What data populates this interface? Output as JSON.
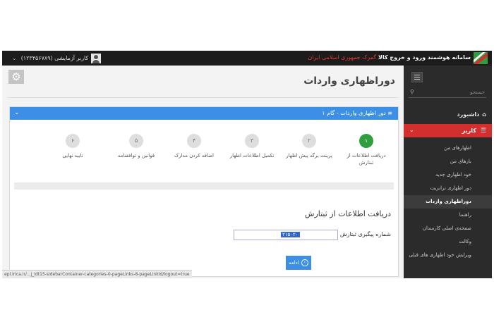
{
  "header": {
    "title_bold": "سامانه هوشمند ورود و خروج کالا",
    "title_org": "گمرک جمهوری اسلامی ایران",
    "user_label": "کاربر آزمایشی (۱۲۳۴۵۶۷۸۹)"
  },
  "sidebar": {
    "search_placeholder": "جستجو",
    "dashboard": "داشبورد",
    "active_section": "کاربر",
    "items": [
      {
        "label": "اظهارهای من"
      },
      {
        "label": "بارهای من"
      },
      {
        "label": "خود اظهاری جدید"
      },
      {
        "label": "دور اظهاری ترانزیت"
      },
      {
        "label": "دوراظهاری واردات",
        "selected": true
      },
      {
        "label": "راهنما"
      },
      {
        "label": "صفحه‌ی اصلی کارمندان"
      },
      {
        "label": "وکالت"
      },
      {
        "label": "ویرایش خود اظهاری های قبلی"
      }
    ]
  },
  "main": {
    "page_title": "دوراظهاری واردات",
    "panel_title": "دور اظهاری واردات - گام ۱",
    "steps": [
      {
        "num": "۱",
        "label": "دریافت اطلاعات از ثبتارش",
        "done": true
      },
      {
        "num": "۲",
        "label": "پرینت برگه پیش اظهار",
        "done": false
      },
      {
        "num": "۳",
        "label": "تکمیل اطلاعات اظهار",
        "done": false
      },
      {
        "num": "۴",
        "label": "اضافه کردن مدارک",
        "done": false
      },
      {
        "num": "۵",
        "label": "قوانین و توافقنامه",
        "done": false
      },
      {
        "num": "۶",
        "label": "تایید نهایی",
        "done": false
      }
    ],
    "section_title": "دریافت اطلاعات از ثبتارش",
    "field_label": "شماره پیگیری ثبتارش",
    "field_value": "۲۱۵۰۲۰",
    "next_button": "ادامه"
  },
  "status_url": "epl.irica.ir/...j_idt15-sidebarContainer-categories-0-pageLinks-8-pageLinkId/logout=true",
  "colors": {
    "accent_blue": "#3d8fe6",
    "active_red": "#d32f2f",
    "step_green": "#2e9e3e",
    "header_black": "#1c1c1c"
  }
}
